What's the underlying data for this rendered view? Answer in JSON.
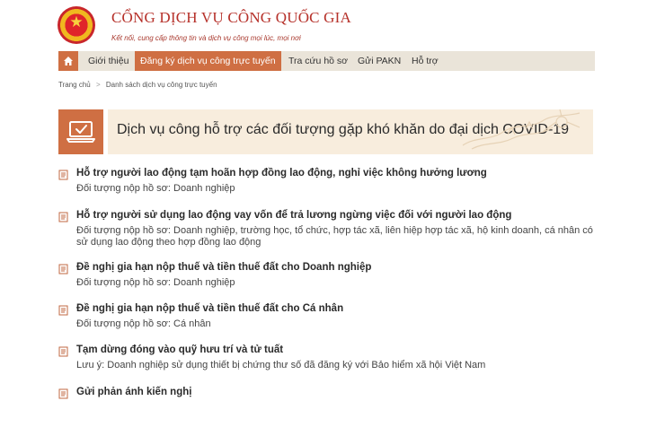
{
  "header": {
    "title": "CỔNG DỊCH VỤ CÔNG QUỐC GIA",
    "slogan": "Kết nối, cung cấp thông tin và dịch vụ công mọi lúc, mọi nơi"
  },
  "nav": {
    "items": [
      {
        "label": "Giới thiệu"
      },
      {
        "label": "Đăng ký dịch vụ công trực tuyến"
      },
      {
        "label": "Tra cứu hồ sơ"
      },
      {
        "label": "Gửi PAKN"
      },
      {
        "label": "Hỗ trợ"
      }
    ]
  },
  "breadcrumb": {
    "home": "Trang chủ",
    "separator": ">",
    "current": "Danh sách dịch vụ công trực tuyến"
  },
  "banner": {
    "title": "Dịch vụ công hỗ trợ các đối tượng gặp khó khăn do đại dịch COVID-19"
  },
  "services": [
    {
      "title": "Hỗ trợ người lao động tạm hoãn hợp đồng lao động, nghỉ việc không hưởng lương",
      "subtitle": "Đối tượng nộp hồ sơ: Doanh nghiệp"
    },
    {
      "title": "Hỗ trợ người sử dụng lao động vay vốn để trả lương ngừng việc đối với người lao động",
      "subtitle": "Đối tượng nộp hồ sơ: Doanh nghiệp, trường học, tổ chức, hợp tác xã, liên hiệp hợp tác xã, hộ kinh doanh, cá nhân có sử dụng lao động theo hợp đồng lao động"
    },
    {
      "title": "Đề nghị gia hạn nộp thuế và tiền thuế đất cho Doanh nghiệp",
      "subtitle": "Đối tượng nộp hồ sơ: Doanh nghiệp"
    },
    {
      "title": "Đề nghị gia hạn nộp thuế và tiền thuế đất cho Cá nhân",
      "subtitle": "Đối tượng nộp hồ sơ: Cá nhân"
    },
    {
      "title": "Tạm dừng đóng vào quỹ hưu trí và tử tuất",
      "subtitle": "Lưu ý: Doanh nghiệp sử dụng thiết bị chứng thư số đã đăng ký với Bảo hiểm xã hội Việt Nam"
    },
    {
      "title": "Gửi phản ánh kiến nghị",
      "subtitle": ""
    }
  ],
  "colors": {
    "accent": "#cf6f43",
    "nav_bg": "#eae4d9",
    "banner_bg": "#f8eddd",
    "brand_red": "#b6312a"
  },
  "icons": {
    "home": "home-icon",
    "banner": "laptop-check-icon",
    "service": "document-icon",
    "emblem": "national-emblem"
  }
}
